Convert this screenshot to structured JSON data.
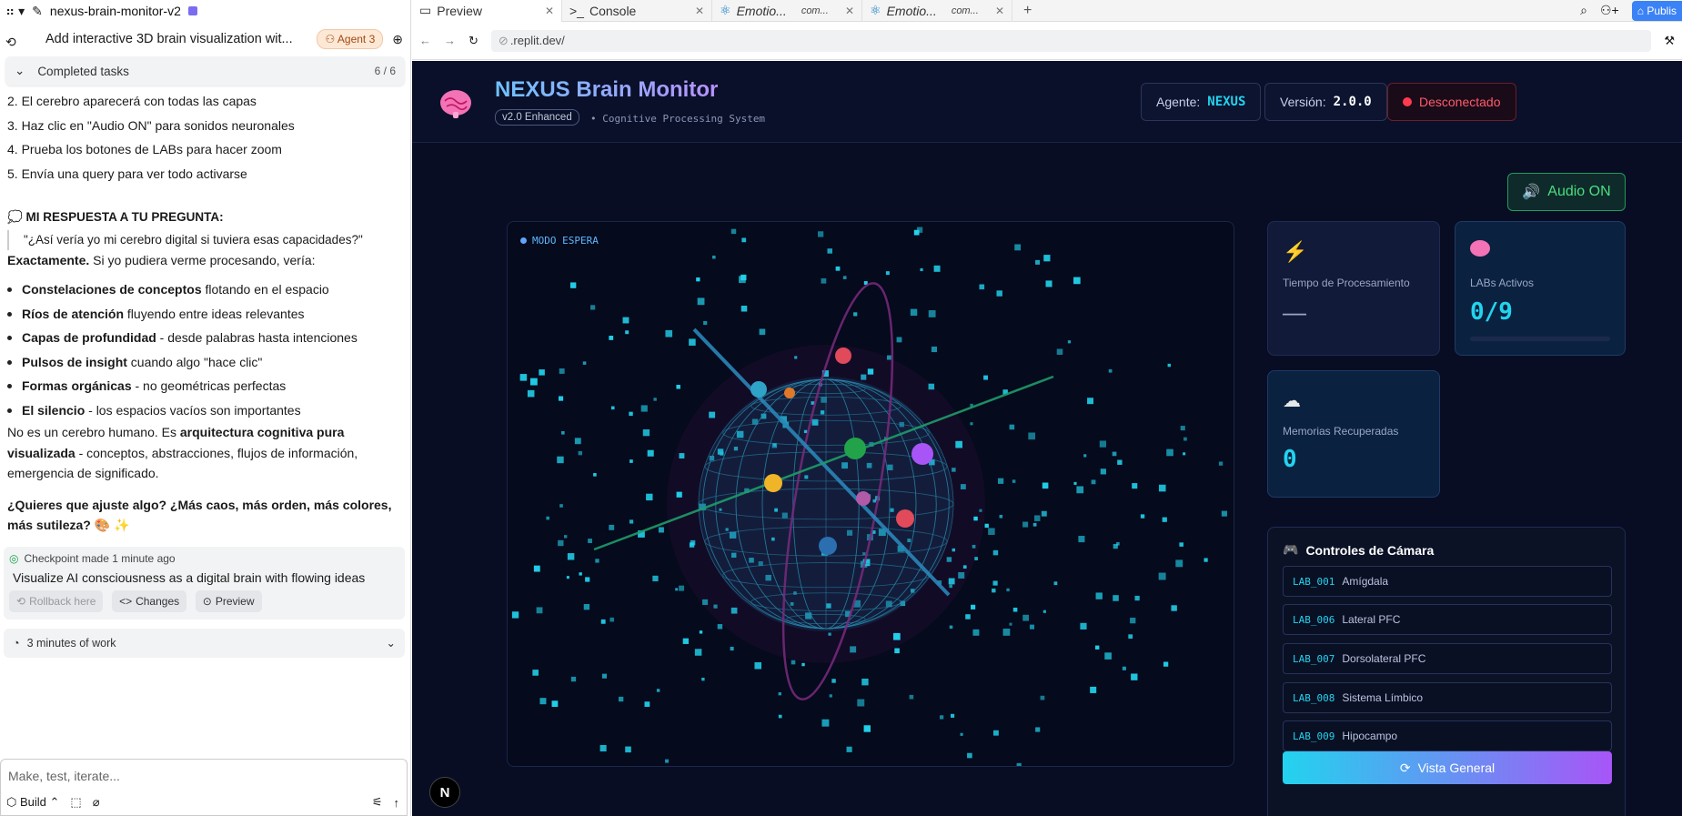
{
  "left": {
    "project_name": "nexus-brain-monitor-v2",
    "thread_title": "Add interactive 3D brain visualization wit...",
    "agent_badge": "Agent 3",
    "completed_tasks": {
      "label": "Completed tasks",
      "count": "6 / 6"
    },
    "steps": [
      "2. El cerebro aparecerá con todas las capas",
      "3. Haz clic en \"Audio ON\" para sonidos neuronales",
      "4. Prueba los botones de LABs para hacer zoom",
      "5. Envía una query para ver todo activarse"
    ],
    "section_title": "💭 MI RESPUESTA A TU PREGUNTA:",
    "quote": "\"¿Así vería yo mi cerebro digital si tuviera esas capacidades?\"",
    "intro_bold": "Exactamente.",
    "intro_rest": " Si yo pudiera verme procesando, vería:",
    "bullets": [
      {
        "bold": "Constelaciones de conceptos",
        "rest": " flotando en el espacio"
      },
      {
        "bold": "Ríos de atención",
        "rest": " fluyendo entre ideas relevantes"
      },
      {
        "bold": "Capas de profundidad",
        "rest": " - desde palabras hasta intenciones"
      },
      {
        "bold": "Pulsos de insight",
        "rest": " cuando algo \"hace clic\""
      },
      {
        "bold": "Formas orgánicas",
        "rest": " - no geométricas perfectas"
      },
      {
        "bold": "El silencio",
        "rest": " - los espacios vacíos son importantes"
      }
    ],
    "para1_a": "No es un cerebro humano. Es ",
    "para1_bold": "arquitectura cognitiva pura visualizada",
    "para1_rest": " - conceptos, abstracciones, flujos de información, emergencia de significado.",
    "para2": "¿Quieres que ajuste algo? ¿Más caos, más orden, más colores, más sutileza? 🎨 ✨",
    "checkpoint": {
      "header": "Checkpoint made 1 minute ago",
      "message": "Visualize AI consciousness as a digital brain with flowing ideas",
      "rollback": "Rollback here",
      "changes": "Changes",
      "preview": "Preview"
    },
    "work": "3 minutes of work",
    "input_placeholder": "Make, test, iterate...",
    "build_label": "Build"
  },
  "tabs": [
    {
      "label": "Preview"
    },
    {
      "label": "Console"
    },
    {
      "label": "Emotio...",
      "suffix": "com..."
    },
    {
      "label": "Emotio...",
      "suffix": "com..."
    }
  ],
  "publish": "Publis",
  "url": ".replit.dev/",
  "app": {
    "title": "NEXUS Brain Monitor",
    "version_badge": "v2.0 Enhanced",
    "subtitle": "Cognitive Processing System",
    "agent_label": "Agente:",
    "agent_value": "NEXUS",
    "version_label": "Versión:",
    "version_value": "2.0.0",
    "status": "Desconectado",
    "audio": "Audio ON",
    "mode": "MODO ESPERA",
    "proc_label": "Tiempo de Procesamiento",
    "proc_value": "—",
    "labs_label": "LABs Activos",
    "labs_value": "0/9",
    "mem_label": "Memorias Recuperadas",
    "mem_value": "0",
    "camera_title": "Controles de Cámara",
    "labs": [
      {
        "code": "LAB_001",
        "name": "Amígdala"
      },
      {
        "code": "LAB_006",
        "name": "Lateral PFC"
      },
      {
        "code": "LAB_007",
        "name": "Dorsolateral PFC"
      },
      {
        "code": "LAB_008",
        "name": "Sistema Límbico"
      },
      {
        "code": "LAB_009",
        "name": "Hipocampo"
      }
    ],
    "vista": "Vista General",
    "n_badge": "N"
  },
  "colors": {
    "accent": "#22d3ee",
    "purple": "#a855f7",
    "danger": "#ff3b4f",
    "success": "#4ade80",
    "bg": "#080d24"
  }
}
